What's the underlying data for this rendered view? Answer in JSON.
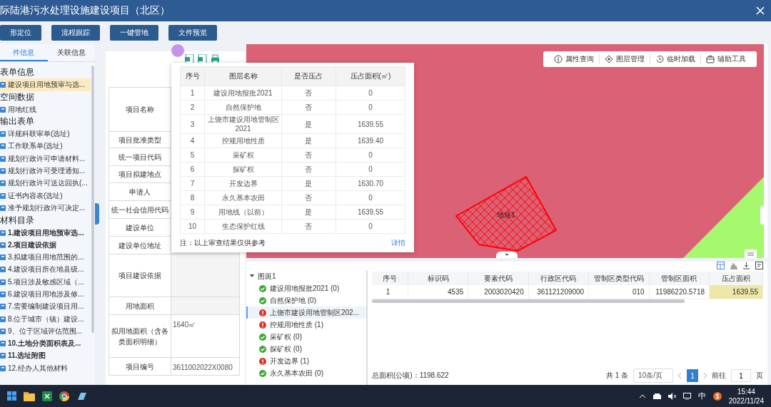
{
  "window": {
    "title": "际陆港污水处理设施建设项目（北区）"
  },
  "toolbar": {
    "buttons": [
      "形定位",
      "流程跟踪",
      "一键管地",
      "文件预览"
    ]
  },
  "sidebar": {
    "tabs": [
      {
        "label": "件信息",
        "selected": true
      },
      {
        "label": "关联信息",
        "selected": false
      }
    ],
    "groups": [
      {
        "title": "表单信息",
        "items": [
          {
            "label": "建设项目用地预审与选...",
            "bold": false,
            "selected": true
          }
        ]
      },
      {
        "title": "空间数据",
        "items": [
          {
            "label": "用地红线",
            "bold": false,
            "selected": false
          }
        ]
      },
      {
        "title": "输出表单",
        "items": [
          {
            "label": "详规科联审单(选址)",
            "bold": false,
            "selected": false
          },
          {
            "label": "工作联系单(选址)",
            "bold": false,
            "selected": false
          },
          {
            "label": "规划行政许可申请材料...",
            "bold": false,
            "selected": false
          },
          {
            "label": "规划行政许可受理通知...",
            "bold": false,
            "selected": false
          },
          {
            "label": "规划行政许可送达回执(...",
            "bold": false,
            "selected": false
          },
          {
            "label": "证书内容表(选址)",
            "bold": false,
            "selected": false
          },
          {
            "label": "准予规划行政许可决定...",
            "bold": false,
            "selected": false
          }
        ]
      },
      {
        "title": "材料目录",
        "items": [
          {
            "label": "1.建设项目用地预审选...",
            "bold": true,
            "selected": false
          },
          {
            "label": "2.项目建设依据",
            "bold": true,
            "selected": false
          },
          {
            "label": "3.拟建项目用地范围的...",
            "bold": false,
            "selected": false
          },
          {
            "label": "4.建设项目所在地县级...",
            "bold": false,
            "selected": false
          },
          {
            "label": "5.项目涉及敏感区域（...",
            "bold": false,
            "selected": false
          },
          {
            "label": "6.建设项目用地涉及修...",
            "bold": false,
            "selected": false
          },
          {
            "label": "7.需要编制建设项目用...",
            "bold": false,
            "selected": false
          },
          {
            "label": "8.位于城市（镇）建设...",
            "bold": false,
            "selected": false
          },
          {
            "label": "9、位于区域评估范围...",
            "bold": false,
            "selected": false
          },
          {
            "label": "10.土地分类面积表及...",
            "bold": true,
            "selected": false
          },
          {
            "label": "11.选址附图",
            "bold": true,
            "selected": false
          },
          {
            "label": "12.经办人其他材料",
            "bold": false,
            "selected": false
          }
        ]
      }
    ]
  },
  "form": {
    "rows": [
      {
        "label": "项目名称"
      },
      {
        "label": "项目批准类型"
      },
      {
        "label": "统一项目代码"
      },
      {
        "label": "项目拟建地点"
      },
      {
        "label": "申请人"
      },
      {
        "label": "统一社会信用代码"
      },
      {
        "label": "建设单位"
      },
      {
        "label": "建设单位地址"
      },
      {
        "label": "项目建设依据"
      },
      {
        "label": "用地面积"
      },
      {
        "label": "拟用地面积（含各类面积明细）",
        "value": "1640㎡"
      },
      {
        "label": "项目编号",
        "value": "3611002022X0080"
      }
    ]
  },
  "popup": {
    "columns": [
      "序号",
      "图层名称",
      "是否压占",
      "压占面积(㎡)"
    ],
    "rows": [
      [
        "1",
        "建设用地报批2021",
        "否",
        "0"
      ],
      [
        "2",
        "自然保护地",
        "否",
        "0"
      ],
      [
        "3",
        "上饶市建设用地管制区2021",
        "是",
        "1639.55"
      ],
      [
        "4",
        "控规用地性质",
        "是",
        "1639.40"
      ],
      [
        "5",
        "采矿权",
        "否",
        "0"
      ],
      [
        "6",
        "探矿权",
        "否",
        "0"
      ],
      [
        "7",
        "开发边界",
        "是",
        "1630.70"
      ],
      [
        "8",
        "永久基本农田",
        "否",
        "0"
      ],
      [
        "9",
        "用地线（以前）",
        "是",
        "1639.55"
      ],
      [
        "10",
        "生态保护红线",
        "否",
        "0"
      ]
    ],
    "note": "注：以上审查结果仅供参考",
    "link": "详情"
  },
  "map": {
    "tools": [
      {
        "label": "属性查询",
        "kind": "info"
      },
      {
        "label": "图层管理",
        "kind": "layers"
      },
      {
        "label": "临时加载",
        "kind": "history"
      },
      {
        "label": "辅助工具",
        "kind": "toolbox"
      }
    ],
    "parcel": {
      "label": "地块1"
    }
  },
  "results": {
    "tree": {
      "label": "图斑1",
      "expanded": true,
      "children": [
        {
          "label": "建设用地报批2021 (0)",
          "hit": false,
          "selected": false
        },
        {
          "label": "自然保护地 (0)",
          "hit": false,
          "selected": false
        },
        {
          "label": "上饶市建设用地管制区202...",
          "hit": true,
          "selected": true
        },
        {
          "label": "控规用地性质 (1)",
          "hit": true,
          "selected": false
        },
        {
          "label": "采矿权 (0)",
          "hit": false,
          "selected": false
        },
        {
          "label": "探矿权 (0)",
          "hit": false,
          "selected": false
        },
        {
          "label": "开发边界 (1)",
          "hit": true,
          "selected": false
        },
        {
          "label": "永久基本农田 (0)",
          "hit": false,
          "selected": false
        }
      ]
    },
    "table": {
      "columns": [
        "序号",
        "标识码",
        "要素代码",
        "行政区代码",
        "管制区类型代码",
        "管制区面积",
        "压占面积"
      ],
      "rows": [
        {
          "cells": [
            {
              "text": "1",
              "highlighted": false
            },
            {
              "text": "4535",
              "highlighted": false
            },
            {
              "text": "2003020420",
              "highlighted": false
            },
            {
              "text": "361121209000",
              "highlighted": false
            },
            {
              "text": "010",
              "highlighted": false
            },
            {
              "text": "11986220.5718",
              "highlighted": false
            },
            {
              "text": "1639.55",
              "highlighted": true
            }
          ]
        }
      ]
    },
    "total": "总面积(公顷)：1198.622",
    "pagination": {
      "count": "共 1 条",
      "page_size": "10条/页",
      "pages": [
        {
          "label": "1",
          "selected": true
        }
      ],
      "goto_label": "前往",
      "goto_value": "1",
      "suffix": "页"
    }
  },
  "taskbar": {
    "ime": "中",
    "time": "15:44",
    "date": "2022/11/24"
  }
}
